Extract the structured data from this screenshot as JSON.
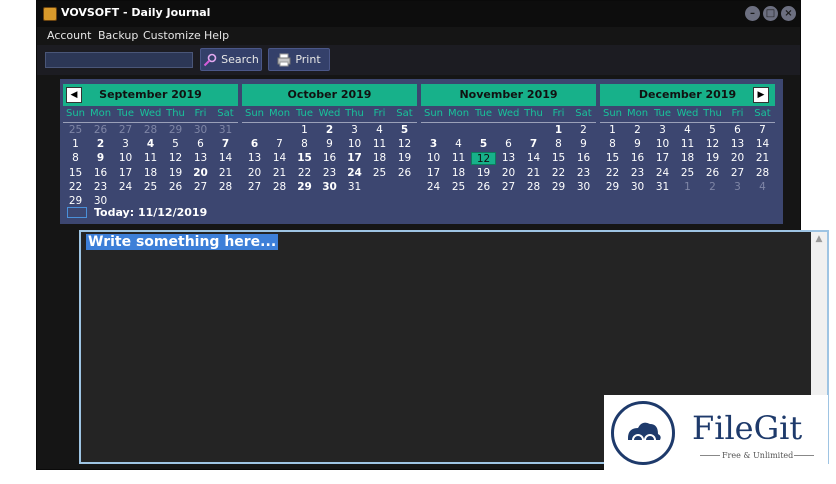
{
  "window": {
    "title": "VOVSOFT - Daily Journal",
    "controls": [
      "minimize-icon",
      "maximize-icon",
      "close-icon"
    ]
  },
  "menu": [
    "Account",
    "Backup",
    "Customize",
    "Help"
  ],
  "toolbar": {
    "search_value": "",
    "search_label": "Search",
    "print_label": "Print"
  },
  "calendar": {
    "weekdays": [
      "Sun",
      "Mon",
      "Tue",
      "Wed",
      "Thu",
      "Fri",
      "Sat"
    ],
    "today_label": "Today: 11/12/2019",
    "months": [
      {
        "title": "September 2019",
        "weeks": [
          [
            "25",
            "26",
            "27",
            "28",
            "29",
            "30",
            "31"
          ],
          [
            "1",
            "2",
            "3",
            "4",
            "5",
            "6",
            "7"
          ],
          [
            "8",
            "9",
            "10",
            "11",
            "12",
            "13",
            "14"
          ],
          [
            "15",
            "16",
            "17",
            "18",
            "19",
            "20",
            "21"
          ],
          [
            "22",
            "23",
            "24",
            "25",
            "26",
            "27",
            "28"
          ],
          [
            "29",
            "30",
            "",
            "",
            "",
            "",
            ""
          ]
        ],
        "bold": [
          "2",
          "4",
          "7",
          "9",
          "20"
        ],
        "other_rows": [
          0
        ]
      },
      {
        "title": "October 2019",
        "weeks": [
          [
            "",
            "",
            "1",
            "2",
            "3",
            "4",
            "5"
          ],
          [
            "6",
            "7",
            "8",
            "9",
            "10",
            "11",
            "12"
          ],
          [
            "13",
            "14",
            "15",
            "16",
            "17",
            "18",
            "19"
          ],
          [
            "20",
            "21",
            "22",
            "23",
            "24",
            "25",
            "26"
          ],
          [
            "27",
            "28",
            "29",
            "30",
            "31",
            "",
            ""
          ]
        ],
        "bold": [
          "2",
          "5",
          "6",
          "15",
          "17",
          "24",
          "29",
          "30"
        ],
        "other_rows": []
      },
      {
        "title": "November 2019",
        "weeks": [
          [
            "",
            "",
            "",
            "",
            "",
            "1",
            "2"
          ],
          [
            "3",
            "4",
            "5",
            "6",
            "7",
            "8",
            "9"
          ],
          [
            "10",
            "11",
            "12",
            "13",
            "14",
            "15",
            "16"
          ],
          [
            "17",
            "18",
            "19",
            "20",
            "21",
            "22",
            "23"
          ],
          [
            "24",
            "25",
            "26",
            "27",
            "28",
            "29",
            "30"
          ]
        ],
        "bold": [
          "1",
          "3",
          "5",
          "7"
        ],
        "today": "12",
        "other_rows": []
      },
      {
        "title": "December 2019",
        "weeks": [
          [
            "1",
            "2",
            "3",
            "4",
            "5",
            "6",
            "7"
          ],
          [
            "8",
            "9",
            "10",
            "11",
            "12",
            "13",
            "14"
          ],
          [
            "15",
            "16",
            "17",
            "18",
            "19",
            "20",
            "21"
          ],
          [
            "22",
            "23",
            "24",
            "25",
            "26",
            "27",
            "28"
          ],
          [
            "29",
            "30",
            "31",
            "1",
            "2",
            "3",
            "4"
          ]
        ],
        "bold": [],
        "trailing_other": [
          "1",
          "2",
          "3",
          "4"
        ],
        "other_rows": []
      }
    ],
    "prev_label": "◀",
    "next_label": "▶"
  },
  "editor": {
    "text": "Write something here..."
  },
  "watermark": {
    "title": "FileGit",
    "subtitle": "Free & Unlimited"
  },
  "colors": {
    "accent": "#17b18a",
    "panel": "#3c4670",
    "selection": "#3d7fd8"
  }
}
